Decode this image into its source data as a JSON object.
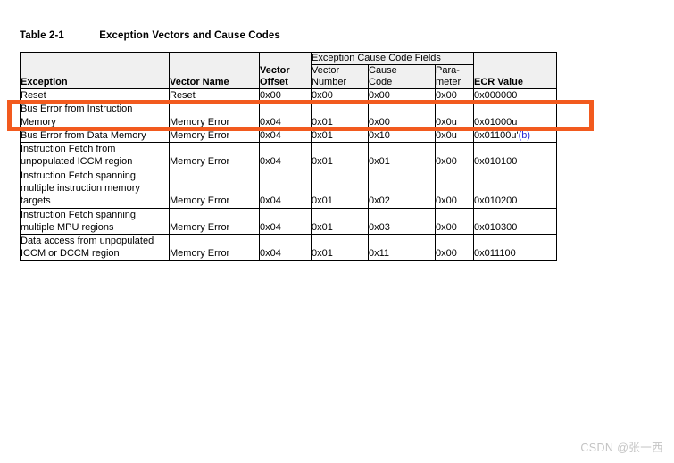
{
  "caption": {
    "label": "Table 2-1",
    "title": "Exception Vectors and Cause Codes"
  },
  "table": {
    "group_header": "Exception Cause Code Fields",
    "columns": [
      {
        "key": "exception",
        "label": "Exception"
      },
      {
        "key": "vector_name",
        "label": "Vector Name"
      },
      {
        "key": "vector_offset",
        "label": "Vector Offset"
      },
      {
        "key": "vector_number",
        "label": "Vector Number"
      },
      {
        "key": "cause_code",
        "label": "Cause Code"
      },
      {
        "key": "parameter",
        "label": "Para- meter"
      },
      {
        "key": "ecr_value",
        "label": "ECR Value"
      }
    ],
    "column_labels": {
      "exception": "Exception",
      "vector_name": "Vector Name",
      "vector_offset_line1": "Vector",
      "vector_offset_line2": "Offset",
      "vector_number_line1": "Vector",
      "vector_number_line2": "Number",
      "cause_code_line1": "Cause",
      "cause_code_line2": "Code",
      "parameter_line1": "Para-",
      "parameter_line2": "meter",
      "ecr_value": "ECR Value"
    },
    "rows": [
      {
        "exception": "Reset",
        "vector_name": "Reset",
        "vector_offset": "0x00",
        "vector_number": "0x00",
        "cause_code": "0x00",
        "parameter": "0x00",
        "ecr_value": "0x000000",
        "ecr_footnote": ""
      },
      {
        "exception": "Bus Error from Instruction Memory",
        "vector_name": "Memory Error",
        "vector_offset": "0x04",
        "vector_number": "0x01",
        "cause_code": "0x00",
        "parameter": "0x0u",
        "ecr_value": "0x01000u",
        "ecr_footnote": ""
      },
      {
        "exception": "Bus Error from Data Memory",
        "vector_name": "Memory Error",
        "vector_offset": "0x04",
        "vector_number": "0x01",
        "cause_code": "0x10",
        "parameter": "0x0u",
        "ecr_value": "0x01100u'",
        "ecr_footnote": "(b)"
      },
      {
        "exception": "Instruction Fetch from unpopulated ICCM region",
        "vector_name": "Memory Error",
        "vector_offset": "0x04",
        "vector_number": "0x01",
        "cause_code": "0x01",
        "parameter": "0x00",
        "ecr_value": "0x010100",
        "ecr_footnote": ""
      },
      {
        "exception": "Instruction Fetch spanning multiple instruction memory targets",
        "vector_name": "Memory Error",
        "vector_offset": "0x04",
        "vector_number": "0x01",
        "cause_code": "0x02",
        "parameter": "0x00",
        "ecr_value": "0x010200",
        "ecr_footnote": ""
      },
      {
        "exception": "Instruction Fetch spanning multiple MPU regions",
        "vector_name": "Memory Error",
        "vector_offset": "0x04",
        "vector_number": "0x01",
        "cause_code": "0x03",
        "parameter": "0x00",
        "ecr_value": "0x010300",
        "ecr_footnote": ""
      },
      {
        "exception": "Data access from unpopulated ICCM or DCCM region",
        "vector_name": "Memory Error",
        "vector_offset": "0x04",
        "vector_number": "0x01",
        "cause_code": "0x11",
        "parameter": "0x00",
        "ecr_value": "0x011100",
        "ecr_footnote": ""
      }
    ]
  },
  "annotation": {
    "type": "highlight-rectangle",
    "color": "#f25a1e",
    "target_row_index": 1
  },
  "watermark": {
    "text": "CSDN @张一西",
    "color": "#c4c4c4"
  }
}
